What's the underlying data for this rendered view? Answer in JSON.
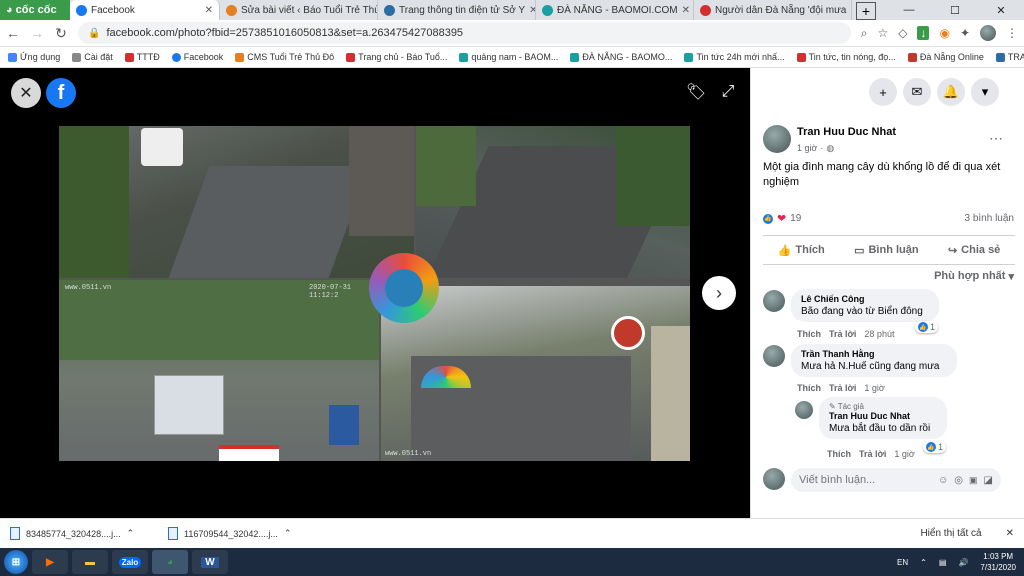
{
  "browser": {
    "brand": "cốc cốc",
    "tabs": [
      {
        "title": "Facebook",
        "color": "#1877f2",
        "active": true
      },
      {
        "title": "Sửa bài viết ‹ Báo Tuổi Trẻ Thủ",
        "color": "#e67e22"
      },
      {
        "title": "Trang thông tin điện tử Sở Y",
        "color": "#2e6da4"
      },
      {
        "title": "ĐÀ NẴNG - BAOMOI.COM",
        "color": "#1aa0a0"
      },
      {
        "title": "Người dân Đà Nẵng 'đội mưa",
        "color": "#d32f2f"
      }
    ],
    "new_tab": "+",
    "url": "facebook.com/photo?fbid=2573851016050813&set=a.263475427088395",
    "bookmarks": [
      {
        "label": "Ứng dụng",
        "color": "#4285f4"
      },
      {
        "label": "Cài đặt",
        "color": "#888"
      },
      {
        "label": "TTTĐ",
        "color": "#d32f2f"
      },
      {
        "label": "Facebook",
        "color": "#1877f2"
      },
      {
        "label": "CMS Tuổi Trẻ Thủ Đô",
        "color": "#e67e22"
      },
      {
        "label": "Trang chủ - Báo Tuổ...",
        "color": "#d32f2f"
      },
      {
        "label": "quảng nam - BAOM...",
        "color": "#1aa0a0"
      },
      {
        "label": "ĐÀ NẴNG - BAOMO...",
        "color": "#1aa0a0"
      },
      {
        "label": "Tin tức 24h mới nhấ...",
        "color": "#1aa0a0"
      },
      {
        "label": "Tin tức, tin nóng, đọ...",
        "color": "#d32f2f"
      },
      {
        "label": "Đà Nẵng Online",
        "color": "#c0392b"
      },
      {
        "label": "TRANG TIN VỀ DỊCH...",
        "color": "#2e6da4"
      }
    ]
  },
  "photo": {
    "stamp1": "www.0511.vn",
    "stamp2": "2020-07-31 11:12:2",
    "stamp3": "www.0511.vn"
  },
  "post": {
    "author": "Tran Huu Duc Nhat",
    "time": "1 giờ",
    "caption": "Một gia đình mang cây dù khổng lồ để đi qua xét nghiệm",
    "reaction_count": "19",
    "comment_count": "3 bình luận",
    "actions": {
      "like": "Thích",
      "comment": "Bình luận",
      "share": "Chia sẻ"
    },
    "sort": "Phù hợp nhất"
  },
  "comments": [
    {
      "name": "Lê Chiến Công",
      "text": "Bão đang vào từ Biển đông",
      "like": "Thích",
      "reply": "Trả lời",
      "time": "28 phút",
      "reacts": "1"
    },
    {
      "name": "Trần Thanh Hằng",
      "text": "Mưa hả N.Huế cũng đang mưa",
      "like": "Thích",
      "reply": "Trả lời",
      "time": "1 giờ"
    },
    {
      "badge": "Tác giả",
      "name": "Tran Huu Duc Nhat",
      "text": "Mưa bắt đầu to dần rồi",
      "like": "Thích",
      "reply": "Trả lời",
      "time": "1 giờ",
      "reacts": "1"
    }
  ],
  "comment_input": {
    "placeholder": "Viết bình luận..."
  },
  "downloads": {
    "items": [
      {
        "name": "83485774_320428....j..."
      },
      {
        "name": "116709544_32042....j..."
      }
    ],
    "show_all": "Hiển thị tất cả"
  },
  "taskbar": {
    "lang": "EN",
    "time": "1:03 PM",
    "date": "7/31/2020",
    "zalo": "Zalo",
    "word": "W"
  }
}
